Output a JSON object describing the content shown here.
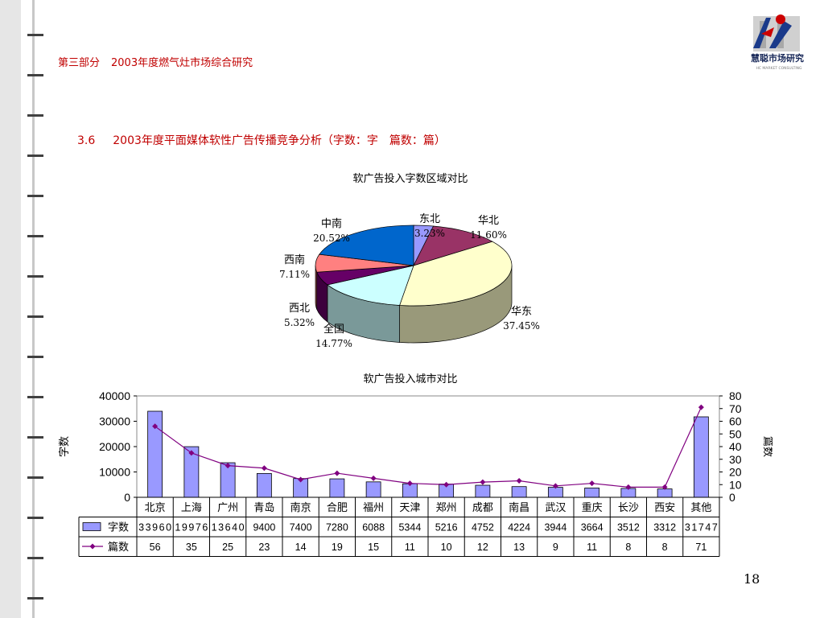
{
  "header": {
    "part": "第三部分",
    "title": "2003年度燃气灶市场综合研究"
  },
  "logo": {
    "brand": "慧聪市场研究",
    "subtitle": "HC MARKET CONSULTING"
  },
  "section": {
    "number": "3.6",
    "title": "2003年度平面媒体软性广告传播竞争分析（字数：字　篇数：篇）"
  },
  "page_number": "18",
  "colors": {
    "red": "#c00000",
    "bar": "#9999ff",
    "line": "#800080"
  },
  "chart_data": [
    {
      "type": "pie",
      "title": "软广告投入字数区域对比",
      "slices": [
        {
          "name": "东北",
          "value": 3.23,
          "label": "3.23%",
          "color": "#9999ff",
          "side": "#5b5b99"
        },
        {
          "name": "华北",
          "value": 11.6,
          "label": "11.60%",
          "color": "#993366",
          "side": "#5c1f3d"
        },
        {
          "name": "华东",
          "value": 37.45,
          "label": "37.45%",
          "color": "#ffffcc",
          "side": "#99997a"
        },
        {
          "name": "全国",
          "value": 14.77,
          "label": "14.77%",
          "color": "#ccffff",
          "side": "#7a9999"
        },
        {
          "name": "西北",
          "value": 5.32,
          "label": "5.32%",
          "color": "#660066",
          "side": "#3d003d"
        },
        {
          "name": "西南",
          "value": 7.11,
          "label": "7.11%",
          "color": "#ff8080",
          "side": "#994d4d"
        },
        {
          "name": "中南",
          "value": 20.52,
          "label": "20.52%",
          "color": "#0066cc",
          "side": "#003d7a"
        }
      ]
    },
    {
      "type": "bar",
      "title": "软广告投入城市对比",
      "categories": [
        "北京",
        "上海",
        "广州",
        "青岛",
        "南京",
        "合肥",
        "福州",
        "天津",
        "郑州",
        "成都",
        "南昌",
        "武汉",
        "重庆",
        "长沙",
        "西安",
        "其他"
      ],
      "series": [
        {
          "name": "字数",
          "type": "bar",
          "axis": "left",
          "values": [
            33960,
            19976,
            13640,
            9400,
            7400,
            7280,
            6088,
            5344,
            5216,
            4752,
            4224,
            3944,
            3664,
            3512,
            3312,
            31747
          ]
        },
        {
          "name": "篇数",
          "type": "line",
          "axis": "right",
          "values": [
            56,
            35,
            25,
            23,
            14,
            19,
            15,
            11,
            10,
            12,
            13,
            9,
            11,
            8,
            8,
            71
          ]
        }
      ],
      "ylabel": "字数",
      "ylabel_right": "篇数",
      "ylim": [
        0,
        40000
      ],
      "yticks": [
        0,
        10000,
        20000,
        30000,
        40000
      ],
      "ylim_right": [
        0,
        80
      ],
      "yticks_right": [
        0,
        10,
        20,
        30,
        40,
        50,
        60,
        70,
        80
      ],
      "grid": false,
      "legend": "data-table"
    }
  ]
}
